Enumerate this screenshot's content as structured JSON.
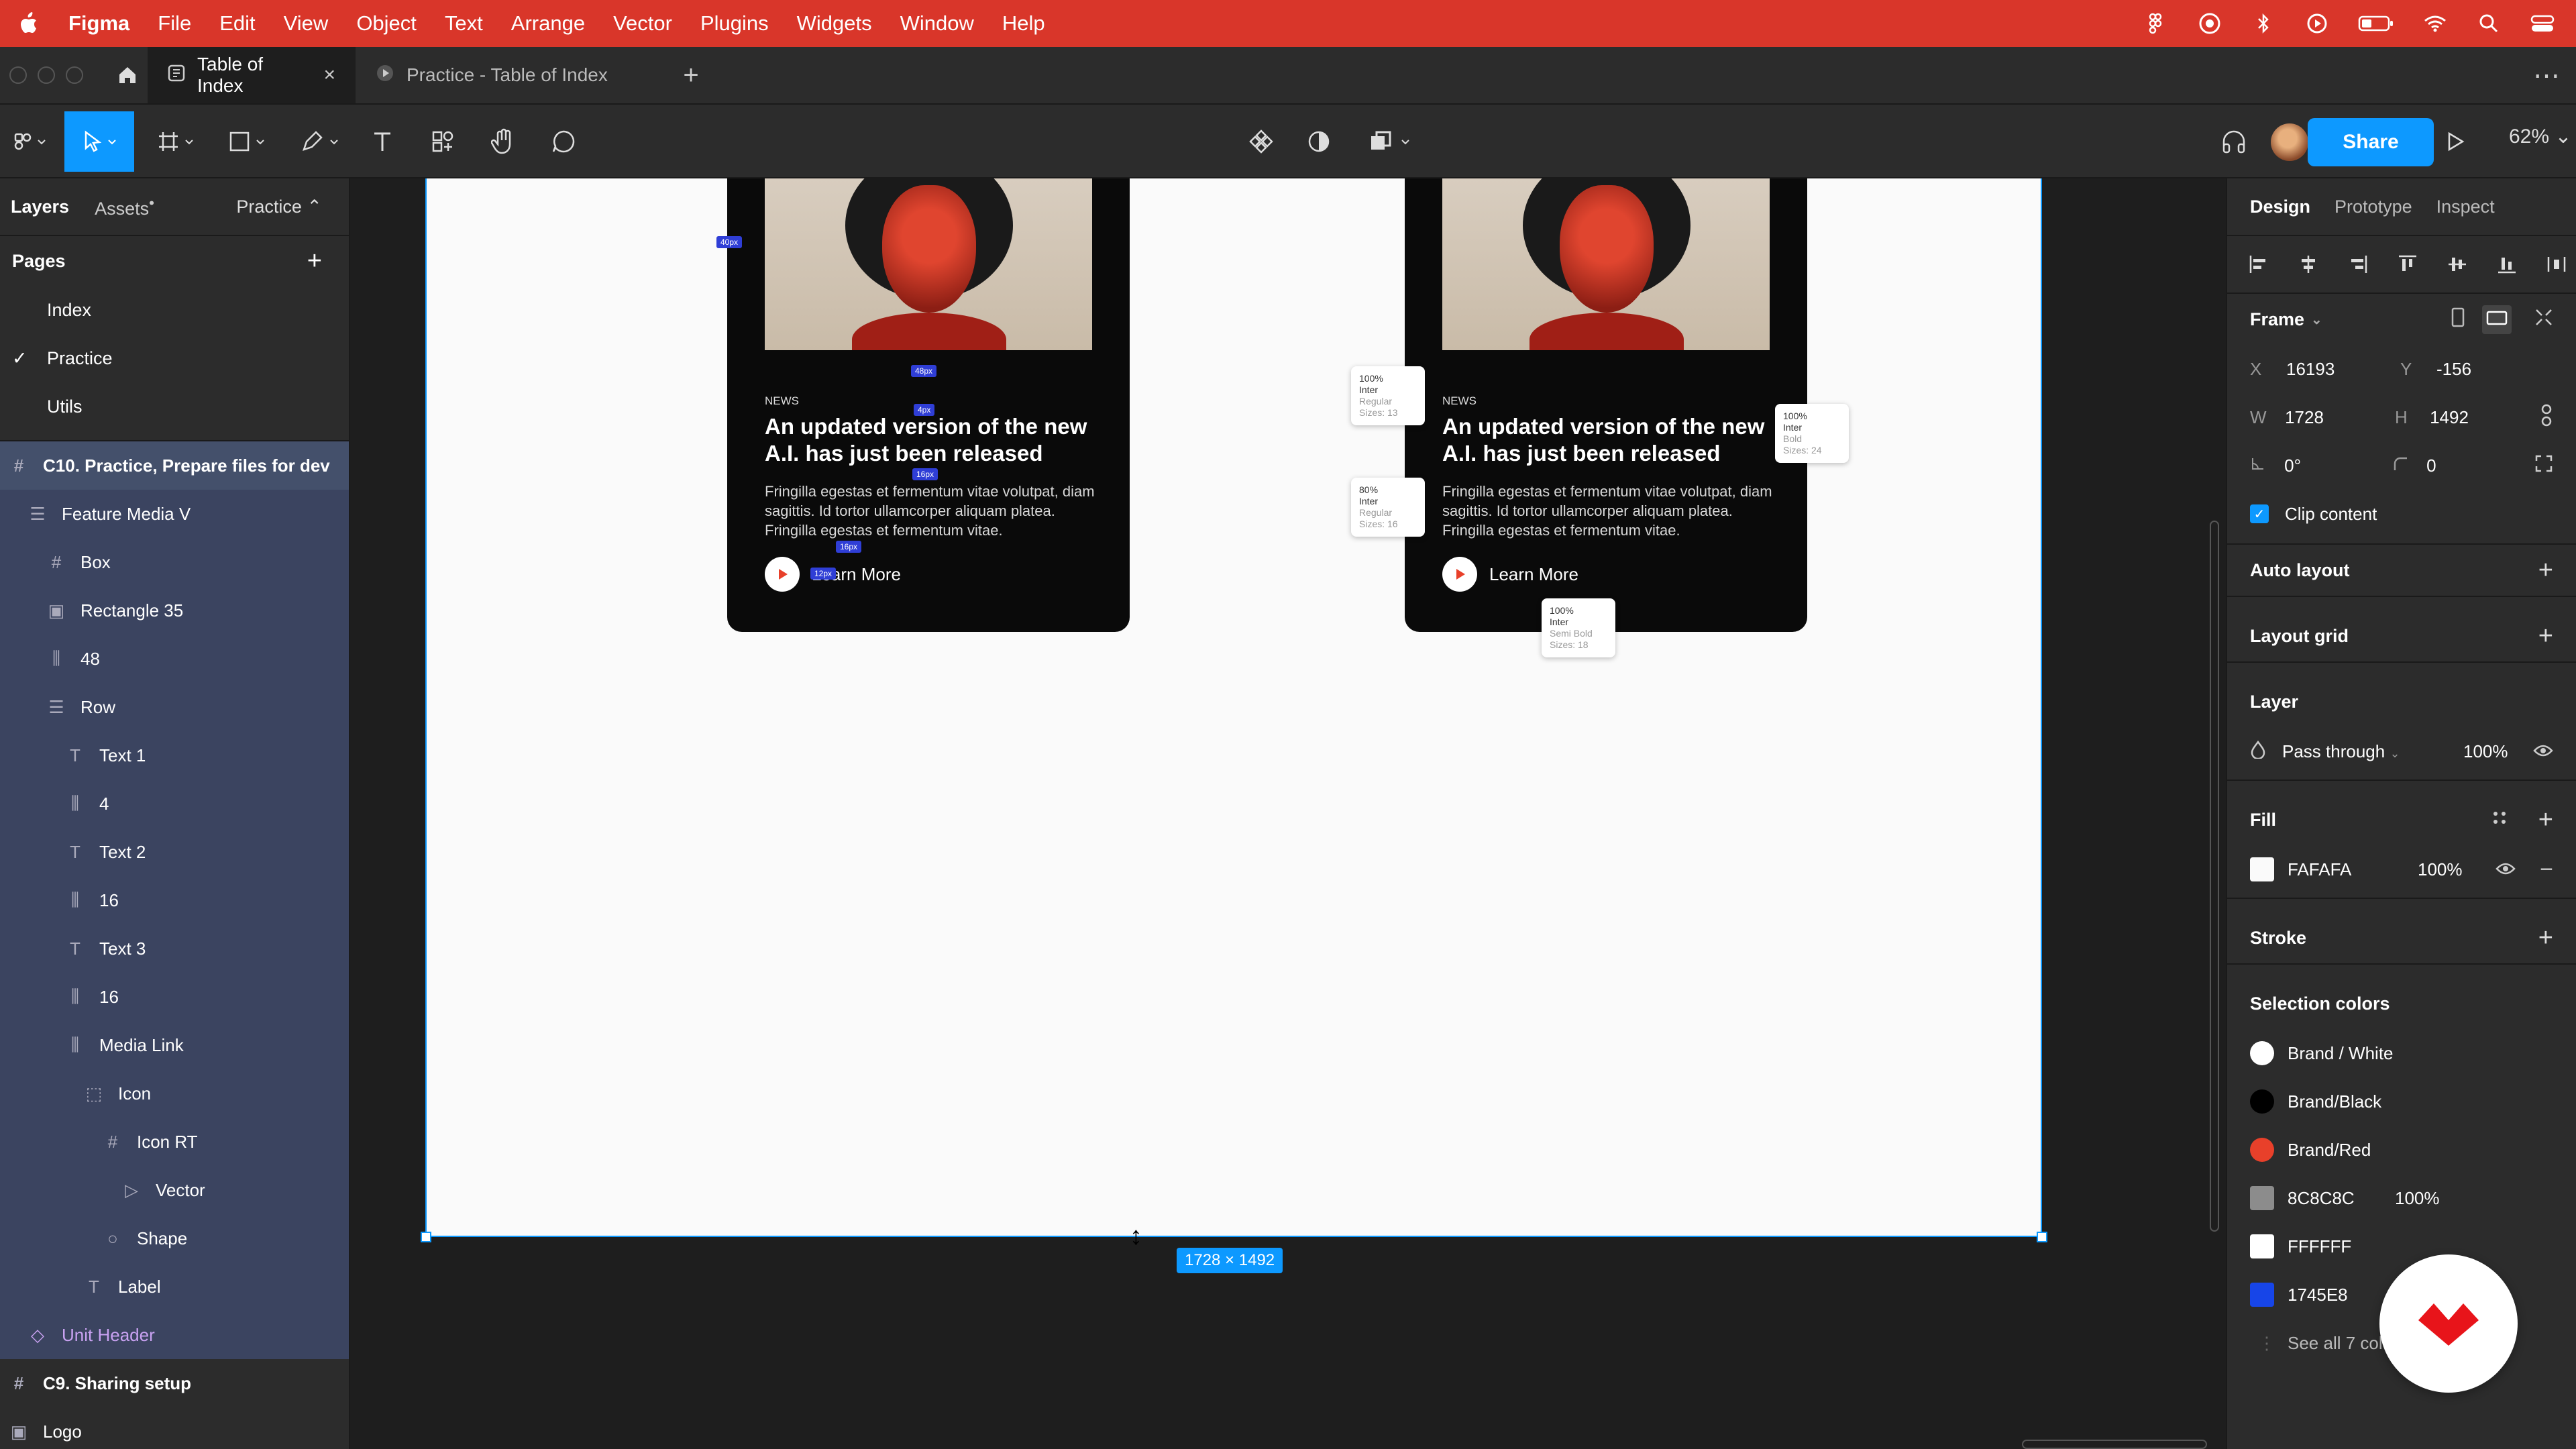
{
  "menubar": {
    "app": "Figma",
    "items": [
      "File",
      "Edit",
      "View",
      "Object",
      "Text",
      "Arrange",
      "Vector",
      "Plugins",
      "Widgets",
      "Window",
      "Help"
    ]
  },
  "tabs": [
    {
      "label": "Table of Index",
      "active": true
    },
    {
      "label": "Practice - Table of Index",
      "active": false
    }
  ],
  "toolbar": {
    "share_label": "Share",
    "zoom": "62%"
  },
  "left_panel": {
    "tabs": {
      "layers": "Layers",
      "assets": "Assets",
      "page": "Practice"
    },
    "pages_label": "Pages",
    "pages": [
      {
        "label": "Index",
        "checked": false
      },
      {
        "label": "Practice",
        "checked": true
      },
      {
        "label": "Utils",
        "checked": false
      }
    ],
    "layers": [
      {
        "label": "C10. Practice, Prepare files for dev",
        "icon": "frame-icon",
        "indent": 0
      },
      {
        "label": "Feature Media V",
        "icon": "autolayout-v-icon",
        "indent": 1
      },
      {
        "label": "Box",
        "icon": "frame-icon",
        "indent": 2
      },
      {
        "label": "Rectangle 35",
        "icon": "image-icon",
        "indent": 2
      },
      {
        "label": "48",
        "icon": "spacer-icon",
        "indent": 2
      },
      {
        "label": "Row",
        "icon": "autolayout-v-icon",
        "indent": 2
      },
      {
        "label": "Text 1",
        "icon": "text-icon",
        "indent": 3
      },
      {
        "label": "4",
        "icon": "spacer-icon",
        "indent": 3
      },
      {
        "label": "Text 2",
        "icon": "text-icon",
        "indent": 3
      },
      {
        "label": "16",
        "icon": "spacer-icon",
        "indent": 3
      },
      {
        "label": "Text 3",
        "icon": "text-icon",
        "indent": 3
      },
      {
        "label": "16",
        "icon": "spacer-icon",
        "indent": 3
      },
      {
        "label": "Media Link",
        "icon": "spacer-icon",
        "indent": 3
      },
      {
        "label": "Icon",
        "icon": "dashed-frame-icon",
        "indent": 4
      },
      {
        "label": "Icon RT",
        "icon": "frame-icon",
        "indent": 5
      },
      {
        "label": "Vector",
        "icon": "triangle-icon",
        "indent": 6
      },
      {
        "label": "Shape",
        "icon": "ellipse-icon",
        "indent": 5
      },
      {
        "label": "Label",
        "icon": "text-icon",
        "indent": 4
      },
      {
        "label": "Unit Header",
        "icon": "component-icon",
        "indent": 1
      },
      {
        "label": "C9. Sharing setup",
        "icon": "frame-icon",
        "indent": 0
      },
      {
        "label": "Logo",
        "icon": "image-icon",
        "indent": 0
      }
    ]
  },
  "canvas": {
    "size_label": "1728 × 1492",
    "card": {
      "kicker": "NEWS",
      "title": "An updated version of the new A.I. has just been released",
      "body": "Fringilla egestas et fermentum vitae volutpat, diam sagittis. Id tortor ullamcorper aliquam platea. Fringilla egestas et fermentum vitae.",
      "link": "Learn More"
    },
    "badges": [
      "40px",
      "48px",
      "4px",
      "16px",
      "16px",
      "12px"
    ],
    "tips": [
      {
        "pct": "100%",
        "font": "Inter",
        "style": "Regular",
        "size": "Sizes: 13"
      },
      {
        "pct": "80%",
        "font": "Inter",
        "style": "Regular",
        "size": "Sizes: 16"
      },
      {
        "pct": "100%",
        "font": "Inter",
        "style": "Bold",
        "size": "Sizes: 24"
      },
      {
        "pct": "100%",
        "font": "Inter",
        "style": "Semi Bold",
        "size": "Sizes: 18"
      }
    ]
  },
  "right_panel": {
    "tabs": [
      "Design",
      "Prototype",
      "Inspect"
    ],
    "frame_label": "Frame",
    "x_label": "X",
    "x": "16193",
    "y_label": "Y",
    "y": "-156",
    "w_label": "W",
    "w": "1728",
    "h_label": "H",
    "h": "1492",
    "rotation": "0°",
    "radius": "0",
    "clip_content": "Clip content",
    "auto_layout": "Auto layout",
    "layout_grid": "Layout grid",
    "layer_label": "Layer",
    "blend": "Pass through",
    "layer_opacity": "100%",
    "fill_label": "Fill",
    "fill_hex": "FAFAFA",
    "fill_opacity": "100%",
    "stroke_label": "Stroke",
    "selection_colors_label": "Selection colors",
    "selection_colors": [
      {
        "label": "Brand / White",
        "color": "#ffffff",
        "round": true,
        "opacity": ""
      },
      {
        "label": "Brand/Black",
        "color": "#000000",
        "round": true,
        "opacity": ""
      },
      {
        "label": "Brand/Red",
        "color": "#e8402a",
        "round": true,
        "opacity": ""
      },
      {
        "label": "8C8C8C",
        "color": "#8c8c8c",
        "round": false,
        "opacity": "100%"
      },
      {
        "label": "FFFFFF",
        "color": "#ffffff",
        "round": false,
        "opacity": ""
      },
      {
        "label": "1745E8",
        "color": "#1745e8",
        "round": false,
        "opacity": ""
      }
    ],
    "see_all": "See all 7 colors"
  },
  "colors": {
    "accent": "#0d99ff",
    "menubar": "#d9362a",
    "brand_red": "#e8402a"
  }
}
